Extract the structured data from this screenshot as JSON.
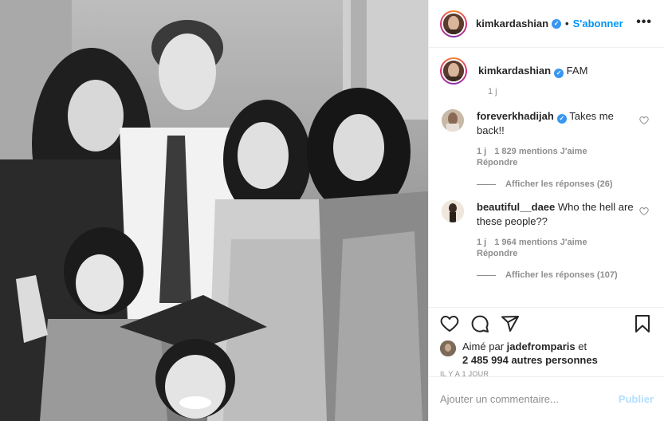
{
  "post": {
    "image_alt": "Black and white family photo"
  },
  "header": {
    "username": "kimkardashian",
    "verified_glyph": "✓",
    "separator": "•",
    "follow_label": "S'abonner",
    "more_glyph": "•••"
  },
  "caption": {
    "username": "kimkardashian",
    "text": "FAM",
    "time": "1 j"
  },
  "comments": [
    {
      "username": "foreverkhadijah",
      "verified": true,
      "text": "Takes me back!!",
      "time": "1 j",
      "likes": "1 829 mentions J'aime",
      "reply_label": "Répondre",
      "view_replies": "Afficher les réponses (26)"
    },
    {
      "username": "beautiful__daee",
      "verified": false,
      "text": "Who the hell are these people??",
      "time": "1 j",
      "likes": "1 964 mentions J'aime",
      "reply_label": "Répondre",
      "view_replies": "Afficher les réponses (107)"
    }
  ],
  "actions": {
    "icons": [
      "heart-icon",
      "comment-icon",
      "share-icon",
      "bookmark-icon"
    ]
  },
  "likes": {
    "prefix": "Aimé par",
    "user": "jadefromparis",
    "conj": "et",
    "others": "2 485 994 autres personnes"
  },
  "timestamp": "IL Y A 1 JOUR",
  "add_comment": {
    "placeholder": "Ajouter un commentaire...",
    "publish_label": "Publier"
  },
  "colors": {
    "accent": "#0095f6",
    "publish_disabled": "#b2dffc",
    "secondary_text": "#8e8e8e",
    "border": "#efefef"
  }
}
